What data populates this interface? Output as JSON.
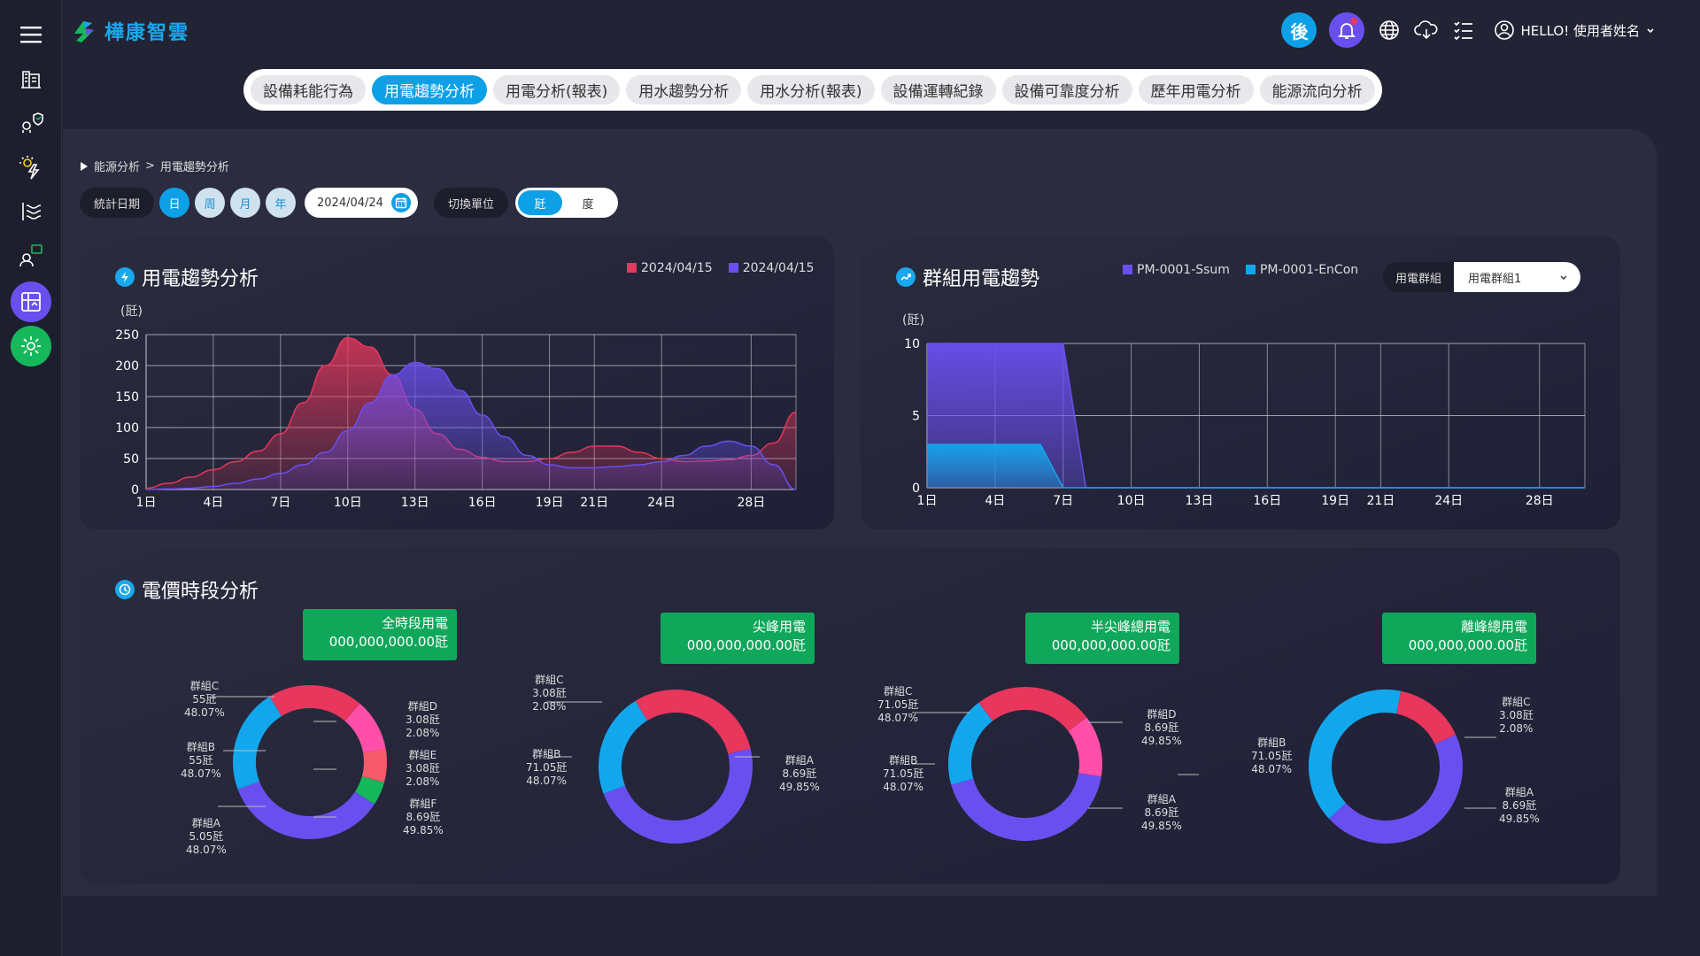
{
  "app": {
    "brand": "樺康智雲"
  },
  "header": {
    "backend_label": "後",
    "user_greeting": "HELLO! 使用者姓名"
  },
  "nav": {
    "tabs": [
      {
        "label": "設備耗能行為",
        "active": false
      },
      {
        "label": "用電趨勢分析",
        "active": true
      },
      {
        "label": "用電分析(報表)",
        "active": false
      },
      {
        "label": "用水趨勢分析",
        "active": false
      },
      {
        "label": "用水分析(報表)",
        "active": false
      },
      {
        "label": "設備運轉紀錄",
        "active": false
      },
      {
        "label": "設備可靠度分析",
        "active": false
      },
      {
        "label": "歷年用電分析",
        "active": false
      },
      {
        "label": "能源流向分析",
        "active": false
      }
    ]
  },
  "breadcrumb": {
    "parent": "能源分析",
    "separator": ">",
    "current": "用電趨勢分析"
  },
  "filters": {
    "date_label": "統計日期",
    "periods": [
      {
        "label": "日",
        "active": true
      },
      {
        "label": "周",
        "active": false
      },
      {
        "label": "月",
        "active": false
      },
      {
        "label": "年",
        "active": false
      }
    ],
    "date_value": "2024/04/24",
    "unit_label": "切換單位",
    "units": [
      {
        "label": "瓩",
        "active": true
      },
      {
        "label": "度",
        "active": false
      }
    ]
  },
  "colors": {
    "accent": "#0ea0e6",
    "red": "#e8365c",
    "purple": "#6a4ff0",
    "cyan": "#12a7ec",
    "pink": "#ff4fa8",
    "coral": "#f75a6a",
    "green": "#16b85c"
  },
  "chart_data": [
    {
      "type": "area",
      "title": "用電趨勢分析",
      "ylabel": "(瓩)",
      "ylim": [
        0,
        250
      ],
      "yticks": [
        0,
        50,
        100,
        150,
        200,
        250
      ],
      "xticks": [
        "1日",
        "4日",
        "7日",
        "10日",
        "13日",
        "16日",
        "19日",
        "21日",
        "24日",
        "28日"
      ],
      "x": [
        1,
        2,
        3,
        4,
        5,
        6,
        7,
        8,
        9,
        10,
        11,
        12,
        13,
        14,
        15,
        16,
        17,
        18,
        19,
        20,
        21,
        22,
        23,
        24,
        25,
        26,
        27,
        28,
        29,
        30
      ],
      "series": [
        {
          "name": "2024/04/15",
          "color": "#e8365c",
          "values": [
            2,
            10,
            20,
            32,
            45,
            62,
            90,
            140,
            200,
            245,
            230,
            185,
            130,
            90,
            65,
            52,
            45,
            45,
            50,
            60,
            70,
            70,
            60,
            50,
            45,
            46,
            48,
            55,
            75,
            125
          ]
        },
        {
          "name": "2024/04/15",
          "color": "#6a4ff0",
          "values": [
            0,
            1,
            2,
            5,
            10,
            17,
            26,
            40,
            60,
            95,
            140,
            185,
            205,
            195,
            160,
            120,
            85,
            55,
            40,
            35,
            35,
            37,
            40,
            45,
            55,
            70,
            78,
            70,
            40,
            0
          ]
        }
      ]
    },
    {
      "type": "area",
      "title": "群組用電趨勢",
      "ylabel": "(瓩)",
      "ylim": [
        0,
        10
      ],
      "yticks": [
        0,
        5,
        10
      ],
      "xticks": [
        "1日",
        "4日",
        "7日",
        "10日",
        "13日",
        "16日",
        "19日",
        "21日",
        "24日",
        "28日"
      ],
      "x": [
        1,
        2,
        3,
        4,
        5,
        6,
        7,
        8,
        9,
        10,
        11,
        12,
        13,
        14,
        15,
        16,
        17,
        18,
        19,
        20,
        21,
        22,
        23,
        24,
        25,
        26,
        27,
        28,
        29,
        30
      ],
      "series": [
        {
          "name": "PM-0001-Ssum",
          "color": "#6a4ff0",
          "values": [
            10,
            10,
            10,
            10,
            10,
            10,
            10,
            0,
            0,
            0,
            0,
            0,
            0,
            0,
            0,
            0,
            0,
            0,
            0,
            0,
            0,
            0,
            0,
            0,
            0,
            0,
            0,
            0,
            0,
            0
          ]
        },
        {
          "name": "PM-0001-EnCon",
          "color": "#12a7ec",
          "values": [
            3,
            3,
            3,
            3,
            3,
            3,
            0,
            0,
            0,
            0,
            0,
            0,
            0,
            0,
            0,
            0,
            0,
            0,
            0,
            0,
            0,
            0,
            0,
            0,
            0,
            0,
            0,
            0,
            0,
            0
          ]
        }
      ]
    },
    {
      "type": "pie",
      "title": "全時段用電",
      "total": "000,000,000.00瓩",
      "slices": [
        {
          "name": "群組C",
          "value": 20,
          "color": "#e8365c"
        },
        {
          "name": "群組D",
          "value": 11,
          "color": "#ff4fa8"
        },
        {
          "name": "群組E",
          "value": 7,
          "color": "#f75a6a"
        },
        {
          "name": "群組F",
          "value": 5,
          "color": "#16b85c"
        },
        {
          "name": "群組A",
          "value": 35,
          "color": "#6a4ff0"
        },
        {
          "name": "群組B",
          "value": 22,
          "color": "#12a7ec"
        }
      ]
    },
    {
      "type": "pie",
      "title": "尖峰用電",
      "total": "000,000,000.00瓩",
      "slices": [
        {
          "name": "群組C",
          "value": 30,
          "color": "#e8365c"
        },
        {
          "name": "群組A",
          "value": 48,
          "color": "#6a4ff0"
        },
        {
          "name": "群組B",
          "value": 22,
          "color": "#12a7ec"
        }
      ]
    },
    {
      "type": "pie",
      "title": "半尖峰總用電",
      "total": "000,000,000.00瓩",
      "slices": [
        {
          "name": "群組C",
          "value": 25,
          "color": "#e8365c"
        },
        {
          "name": "群組D",
          "value": 13,
          "color": "#ff4fa8"
        },
        {
          "name": "群組A",
          "value": 43,
          "color": "#6a4ff0"
        },
        {
          "name": "群組B",
          "value": 19,
          "color": "#12a7ec"
        }
      ]
    },
    {
      "type": "pie",
      "title": "離峰總用電",
      "total": "000,000,000.00瓩",
      "slices": [
        {
          "name": "群組C",
          "value": 15,
          "color": "#e8365c"
        },
        {
          "name": "群組A",
          "value": 45,
          "color": "#6a4ff0"
        },
        {
          "name": "群組B",
          "value": 40,
          "color": "#12a7ec"
        }
      ]
    }
  ],
  "trend_card": {
    "title": "用電趨勢分析",
    "unit": "(瓩)",
    "legend": [
      "2024/04/15",
      "2024/04/15"
    ]
  },
  "group_card": {
    "title": "群組用電趨勢",
    "unit": "(瓩)",
    "legend": [
      "PM-0001-Ssum",
      "PM-0001-EnCon"
    ],
    "select_label": "用電群組",
    "select_value": "用電群組1"
  },
  "price_card": {
    "title": "電價時段分析",
    "donuts": [
      {
        "title": "全時段用電",
        "total": "000,000,000.00瓩",
        "labels": [
          {
            "text": "群組C\n55瓩\n48.07%"
          },
          {
            "text": "群組D\n3.08瓩\n2.08%"
          },
          {
            "text": "群組B\n55瓩\n48.07%"
          },
          {
            "text": "群組E\n3.08瓩\n2.08%"
          },
          {
            "text": "群組F\n8.69瓩\n49.85%"
          },
          {
            "text": "群組A\n5.05瓩\n48.07%"
          }
        ]
      },
      {
        "title": "尖峰用電",
        "total": "000,000,000.00瓩",
        "labels": [
          {
            "text": "群組C\n3.08瓩\n2.08%"
          },
          {
            "text": "群組B\n71.05瓩\n48.07%"
          },
          {
            "text": "群組A\n8.69瓩\n49.85%"
          }
        ]
      },
      {
        "title": "半尖峰總用電",
        "total": "000,000,000.00瓩",
        "labels": [
          {
            "text": "群組C\n71.05瓩\n48.07%"
          },
          {
            "text": "群組D\n8.69瓩\n49.85%"
          },
          {
            "text": "群組B\n71.05瓩\n48.07%"
          },
          {
            "text": "群組A\n8.69瓩\n49.85%"
          }
        ]
      },
      {
        "title": "離峰總用電",
        "total": "000,000,000.00瓩",
        "labels": [
          {
            "text": "群組C\n3.08瓩\n2.08%"
          },
          {
            "text": "群組B\n71.05瓩\n48.07%"
          },
          {
            "text": "群組A\n8.69瓩\n49.85%"
          }
        ]
      }
    ]
  },
  "icons": {
    "sidebar": [
      "menu-icon",
      "building-icon",
      "device-shield-icon",
      "energy-bolt-icon",
      "water-flow-icon",
      "report-user-icon",
      "analysis-chart-icon",
      "settings-gear-icon"
    ],
    "header": [
      "bell-icon",
      "globe-icon",
      "cloud-download-icon",
      "checklist-icon",
      "user-circle-icon",
      "chevron-down-icon"
    ]
  }
}
